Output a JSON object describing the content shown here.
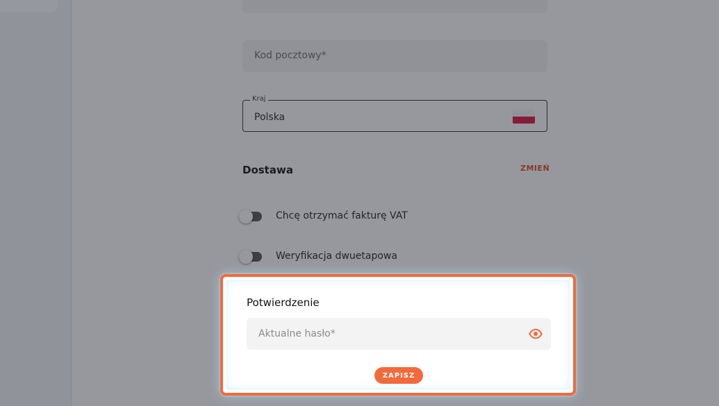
{
  "form": {
    "postal_code_placeholder": "Kod pocztowy*",
    "country_label": "Kraj",
    "country_value": "Polska",
    "country_flag_icon": "poland-flag-icon"
  },
  "delivery": {
    "title": "Dostawa",
    "change_label": "ZMIEŃ"
  },
  "toggles": [
    {
      "label": "Chcę otrzymać fakturę VAT",
      "on": false
    },
    {
      "label": "Weryfikacja dwuetapowa",
      "on": false
    }
  ],
  "confirmation": {
    "title": "Potwierdzenie",
    "password_placeholder": "Aktualne hasło*",
    "password_icon": "eye-icon",
    "save_label": "ZAPISZ"
  },
  "colors": {
    "accent": "#f26a3c",
    "link": "#e8481f",
    "flag_red": "#dc143c"
  }
}
